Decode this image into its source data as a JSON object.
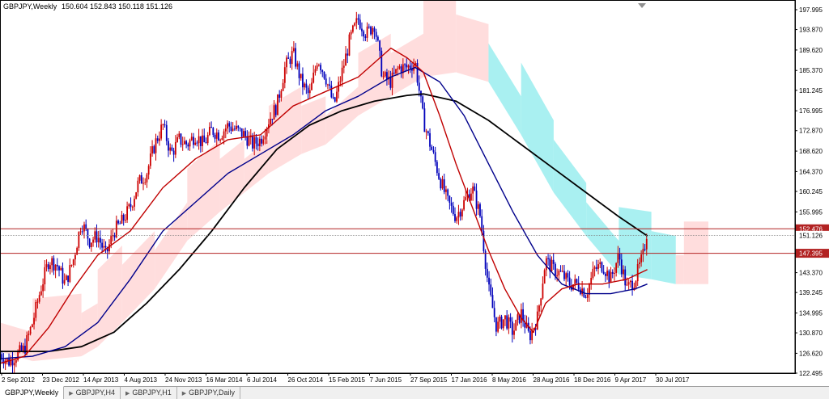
{
  "header": {
    "symbol": "GBPJPY,Weekly",
    "ohlc": "150.604 152.843 150.118 151.126"
  },
  "tabs": [
    {
      "label": "GBPJPY,Weekly",
      "active": true
    },
    {
      "label": "GBPJPY,H4",
      "active": false
    },
    {
      "label": "GBPJPY,H1",
      "active": false
    },
    {
      "label": "GBPJPY,Daily",
      "active": false
    }
  ],
  "colors": {
    "bull": "#cc0000",
    "bear": "#0000bb",
    "ma_fast": "#c00000",
    "ma_mid": "#00008b",
    "ma_slow": "#000000",
    "cloud_bull": "#ffd9d9",
    "cloud_bear": "#a0eef0",
    "hline": "#b22222",
    "current_price": "#808080"
  },
  "chart_data": {
    "type": "candlestick",
    "ylim": [
      122.495,
      199.0
    ],
    "y_ticks": [
      "197.995",
      "193.870",
      "189.620",
      "185.370",
      "181.245",
      "176.995",
      "172.870",
      "168.620",
      "164.370",
      "160.245",
      "155.995",
      "151.126",
      "147.395",
      "143.370",
      "139.245",
      "134.995",
      "130.870",
      "126.620",
      "122.495"
    ],
    "x_ticks": [
      "2 Sep 2012",
      "23 Dec 2012",
      "14 Apr 2013",
      "4 Aug 2013",
      "24 Nov 2013",
      "16 Mar 2014",
      "6 Jul 2014",
      "26 Oct 2014",
      "15 Feb 2015",
      "7 Jun 2015",
      "27 Sep 2015",
      "17 Jan 2016",
      "8 May 2016",
      "28 Aug 2016",
      "18 Dec 2016",
      "9 Apr 2017",
      "30 Jul 2017"
    ],
    "horizontal_lines": [
      {
        "label": "152.476",
        "value": 152.476
      },
      {
        "label": "147.395",
        "value": 147.395
      }
    ],
    "current_price": {
      "label": "151.126",
      "value": 151.126
    },
    "price_path": [
      [
        0,
        126.5
      ],
      [
        10,
        124.8
      ],
      [
        20,
        126.2
      ],
      [
        30,
        127.5
      ],
      [
        40,
        133
      ],
      [
        50,
        140
      ],
      [
        60,
        146
      ],
      [
        70,
        145
      ],
      [
        80,
        141
      ],
      [
        90,
        146
      ],
      [
        100,
        154
      ],
      [
        110,
        150
      ],
      [
        120,
        151
      ],
      [
        130,
        147
      ],
      [
        140,
        152
      ],
      [
        150,
        154
      ],
      [
        160,
        157
      ],
      [
        170,
        162
      ],
      [
        180,
        164
      ],
      [
        190,
        170
      ],
      [
        200,
        174
      ],
      [
        210,
        168
      ],
      [
        220,
        171
      ],
      [
        230,
        170
      ],
      [
        240,
        172
      ],
      [
        250,
        170
      ],
      [
        260,
        173
      ],
      [
        270,
        172
      ],
      [
        280,
        174
      ],
      [
        290,
        173
      ],
      [
        300,
        172
      ],
      [
        310,
        170
      ],
      [
        320,
        171
      ],
      [
        330,
        175
      ],
      [
        340,
        178
      ],
      [
        350,
        186
      ],
      [
        360,
        189
      ],
      [
        370,
        183
      ],
      [
        380,
        180
      ],
      [
        390,
        188
      ],
      [
        400,
        184
      ],
      [
        410,
        178
      ],
      [
        420,
        185
      ],
      [
        430,
        192
      ],
      [
        440,
        196
      ],
      [
        450,
        193
      ],
      [
        460,
        195
      ],
      [
        470,
        184
      ],
      [
        480,
        183
      ],
      [
        490,
        186
      ],
      [
        500,
        186
      ],
      [
        510,
        187
      ],
      [
        520,
        175
      ],
      [
        530,
        169
      ],
      [
        540,
        163
      ],
      [
        550,
        158
      ],
      [
        560,
        155
      ],
      [
        570,
        158
      ],
      [
        580,
        161
      ],
      [
        590,
        155
      ],
      [
        600,
        140
      ],
      [
        610,
        132
      ],
      [
        620,
        134
      ],
      [
        630,
        131
      ],
      [
        640,
        135
      ],
      [
        650,
        130
      ],
      [
        660,
        134
      ],
      [
        670,
        146
      ],
      [
        680,
        144
      ],
      [
        690,
        143
      ],
      [
        700,
        141
      ],
      [
        710,
        141
      ],
      [
        720,
        139
      ],
      [
        730,
        144
      ],
      [
        740,
        145
      ],
      [
        750,
        142
      ],
      [
        760,
        147
      ],
      [
        770,
        140
      ],
      [
        780,
        142
      ],
      [
        790,
        147
      ],
      [
        795,
        152.5
      ]
    ],
    "ma_fast": [
      [
        0,
        124.5
      ],
      [
        30,
        126
      ],
      [
        60,
        132
      ],
      [
        90,
        140
      ],
      [
        120,
        147
      ],
      [
        160,
        152
      ],
      [
        200,
        161
      ],
      [
        240,
        167
      ],
      [
        280,
        171
      ],
      [
        320,
        172
      ],
      [
        360,
        178
      ],
      [
        400,
        181
      ],
      [
        440,
        184
      ],
      [
        480,
        190
      ],
      [
        500,
        188
      ],
      [
        520,
        185
      ],
      [
        540,
        176
      ],
      [
        560,
        166
      ],
      [
        580,
        157
      ],
      [
        600,
        148
      ],
      [
        620,
        140
      ],
      [
        640,
        134
      ],
      [
        655,
        131
      ],
      [
        670,
        137
      ],
      [
        690,
        140
      ],
      [
        710,
        141
      ],
      [
        740,
        141
      ],
      [
        770,
        142
      ],
      [
        795,
        144
      ]
    ],
    "ma_mid": [
      [
        0,
        125.5
      ],
      [
        40,
        126
      ],
      [
        80,
        128
      ],
      [
        120,
        133
      ],
      [
        160,
        142
      ],
      [
        200,
        152
      ],
      [
        240,
        158
      ],
      [
        280,
        164
      ],
      [
        320,
        168
      ],
      [
        360,
        172
      ],
      [
        400,
        177
      ],
      [
        440,
        180
      ],
      [
        480,
        184
      ],
      [
        510,
        186
      ],
      [
        540,
        183
      ],
      [
        570,
        176
      ],
      [
        600,
        166
      ],
      [
        630,
        156
      ],
      [
        660,
        147
      ],
      [
        690,
        141
      ],
      [
        720,
        139
      ],
      [
        750,
        139
      ],
      [
        780,
        140
      ],
      [
        795,
        141
      ]
    ],
    "ma_slow": [
      [
        0,
        127
      ],
      [
        60,
        127
      ],
      [
        100,
        128
      ],
      [
        140,
        131
      ],
      [
        180,
        137
      ],
      [
        220,
        144
      ],
      [
        260,
        152
      ],
      [
        300,
        161
      ],
      [
        340,
        169
      ],
      [
        380,
        174
      ],
      [
        420,
        177
      ],
      [
        460,
        179
      ],
      [
        500,
        180.2
      ],
      [
        520,
        180.5
      ],
      [
        560,
        179
      ],
      [
        600,
        175
      ],
      [
        640,
        170
      ],
      [
        680,
        165
      ],
      [
        720,
        160
      ],
      [
        760,
        155
      ],
      [
        795,
        151
      ]
    ],
    "cloud": [
      [
        0,
        127
      ],
      [
        40,
        125
      ],
      [
        100,
        126
      ],
      [
        120,
        128
      ],
      [
        150,
        133
      ],
      [
        190,
        140
      ],
      [
        230,
        150
      ],
      [
        270,
        156
      ],
      [
        300,
        160
      ],
      [
        330,
        164
      ],
      [
        370,
        168
      ],
      [
        400,
        170
      ],
      [
        440,
        176
      ],
      [
        480,
        180
      ],
      [
        520,
        184
      ],
      [
        560,
        185
      ],
      [
        600,
        183
      ],
      [
        640,
        172
      ],
      [
        680,
        160
      ],
      [
        720,
        151
      ],
      [
        760,
        143
      ],
      [
        800,
        142
      ],
      [
        830,
        141
      ],
      [
        840,
        141
      ],
      [
        870,
        141
      ]
    ]
  }
}
